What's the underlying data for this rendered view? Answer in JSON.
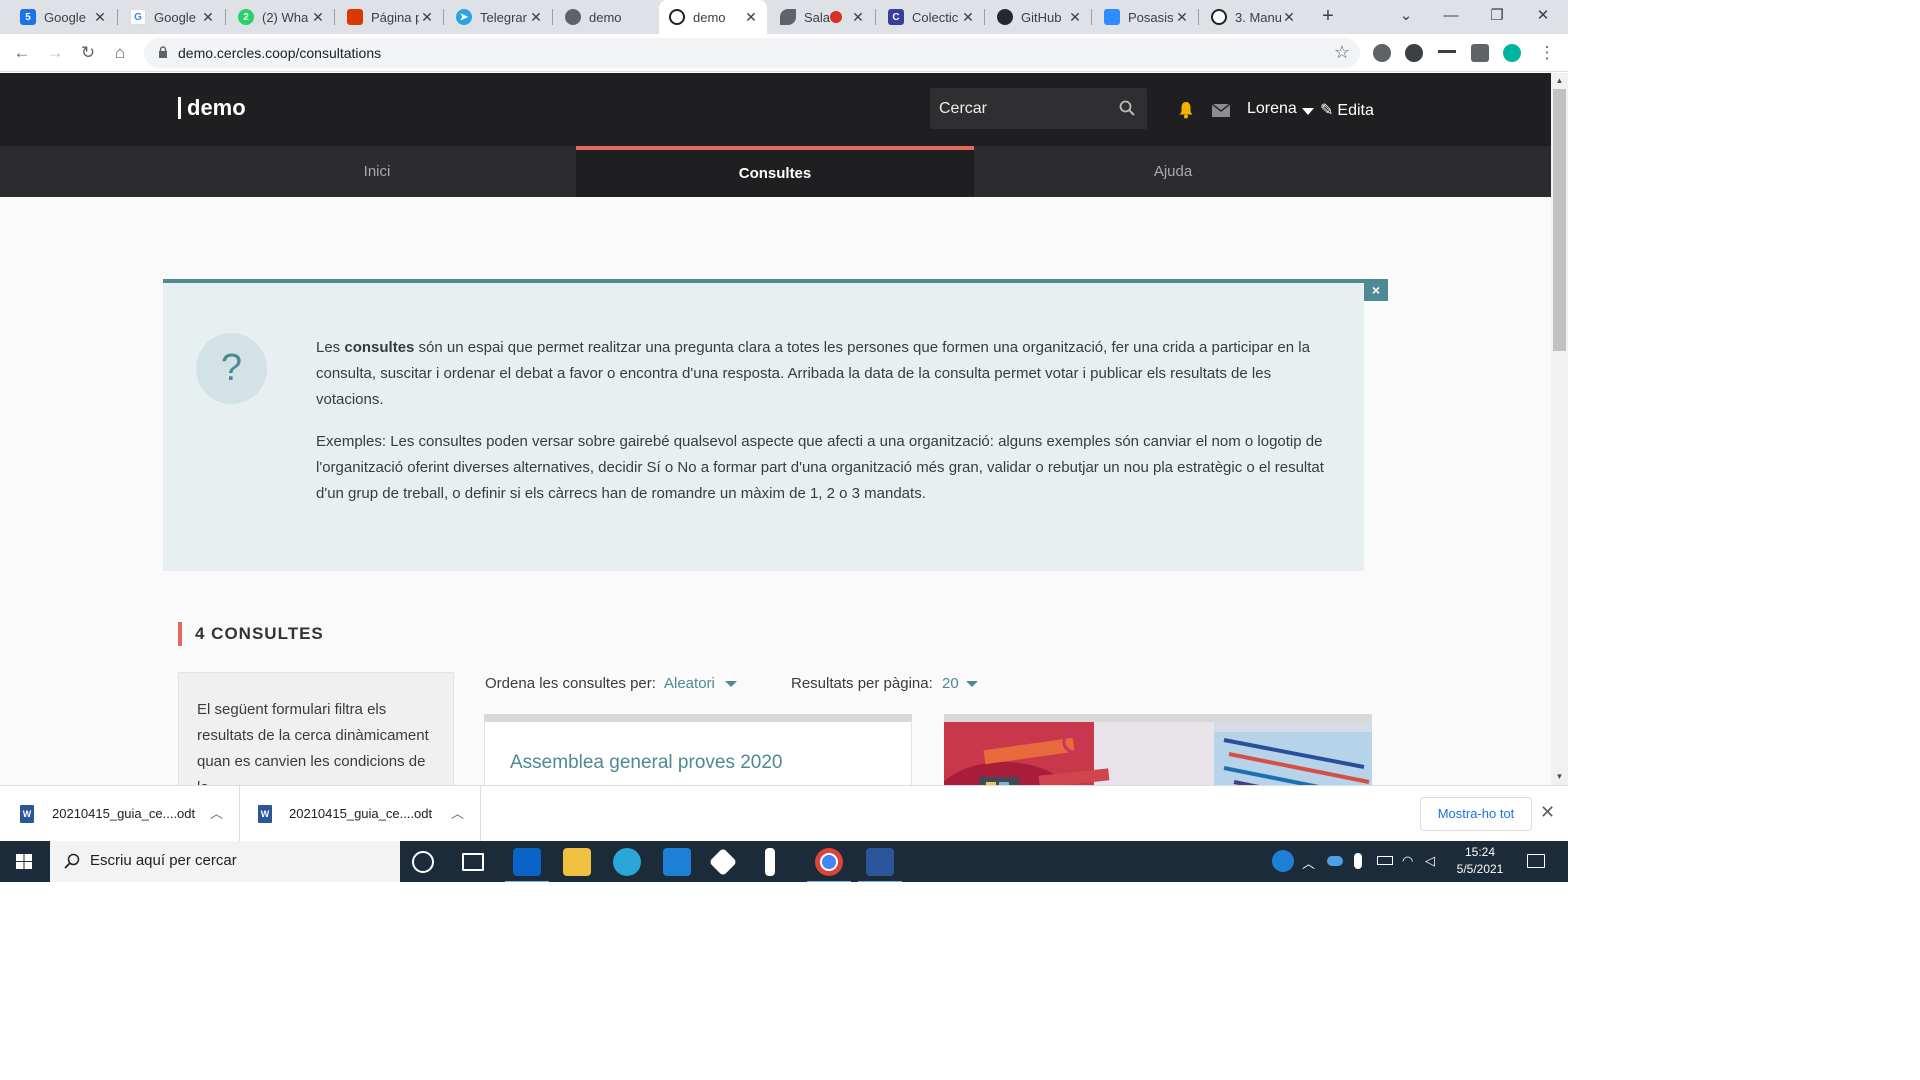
{
  "browser": {
    "tabs": [
      {
        "title": "Google",
        "favicon": "google-sheets-icon",
        "color": "#1a73e8"
      },
      {
        "title": "Google",
        "favicon": "google-icon",
        "color": "#4285f4"
      },
      {
        "title": "(2) Wha",
        "favicon": "whatsapp-icon",
        "color": "#25d366"
      },
      {
        "title": "Página p",
        "favicon": "office-icon",
        "color": "#d83b01"
      },
      {
        "title": "Telegrar",
        "favicon": "telegram-icon",
        "color": "#2aa3df"
      },
      {
        "title": "demo",
        "favicon": "globe-icon",
        "color": "#5f6368"
      },
      {
        "title": "demo",
        "favicon": "circle-icon",
        "color": "#202124"
      },
      {
        "title": "Sala",
        "favicon": "feather-icon",
        "color": "#5f6368"
      },
      {
        "title": "Colectic",
        "favicon": "colectic-icon",
        "color": "#3c3c9c"
      },
      {
        "title": "GitHub",
        "favicon": "github-icon",
        "color": "#24292e"
      },
      {
        "title": "Posasist",
        "favicon": "zoom-icon",
        "color": "#2d8cff"
      },
      {
        "title": "3. Manu",
        "favicon": "circle-icon",
        "color": "#202124"
      }
    ],
    "url": "demo.cercles.coop/consultations"
  },
  "site": {
    "logo": "demo",
    "search_placeholder": "Cercar",
    "user_name": "Lorena",
    "edit_label": "Edita",
    "nav": [
      {
        "label": "Inici"
      },
      {
        "label": "Consultes"
      },
      {
        "label": "Ajuda"
      }
    ]
  },
  "help": {
    "icon_text": "?",
    "p1_before": "Les ",
    "p1_bold": "consultes",
    "p1_after": " són un espai que permet realitzar una pregunta clara a totes les persones que formen una organització, fer una crida a participar en la consulta, suscitar i ordenar el debat a favor o encontra d'una resposta. Arribada la data de la consulta permet votar i publicar els resultats de les votacions.",
    "p2": "Exemples: Les consultes poden versar sobre gairebé qualsevol aspecte que afecti a una organització: alguns exemples són canviar el nom o logotip de l'organització oferint diverses alternatives, decidir Sí o No a formar part d'una organització més gran, validar o rebutjar un nou pla estratègic o el resultat d'un grup de treball, o definir si els càrrecs han de romandre un màxim de 1, 2 o 3 mandats.",
    "close_label": "×"
  },
  "listing": {
    "count_title": "4 CONSULTES",
    "filter_text": "El següent formulari filtra els resultats de la cerca dinàmicament quan es canvien les condicions de la",
    "sort_label": "Ordena les consultes per:",
    "sort_value": "Aleatori",
    "per_page_label": "Resultats per pàgina:",
    "per_page_value": "20",
    "cards": [
      {
        "title": "Assemblea general proves 2020"
      }
    ]
  },
  "downloads": {
    "items": [
      {
        "name": "20210415_guia_ce....odt"
      },
      {
        "name": "20210415_guia_ce....odt"
      }
    ],
    "show_all": "Mostra-ho tot"
  },
  "taskbar": {
    "search_placeholder": "Escriu aquí per cercar",
    "time": "15:24",
    "date": "5/5/2021"
  },
  "colors": {
    "header_bg": "#1f1f21",
    "accent_red": "#e3695d",
    "accent_teal": "#4d8a93",
    "help_bg": "#e7eff0"
  }
}
